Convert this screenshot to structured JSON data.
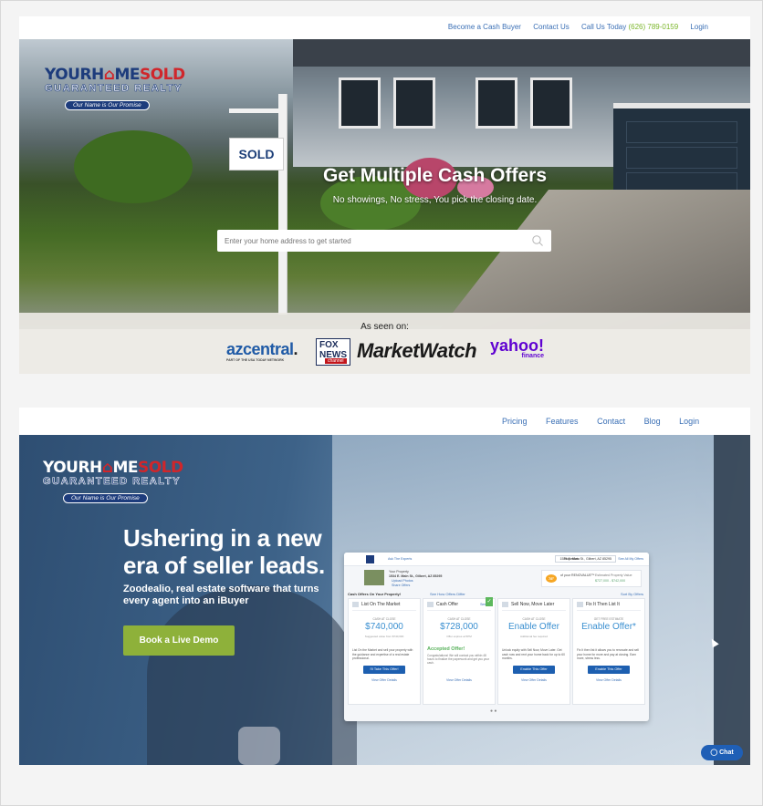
{
  "site1": {
    "nav": {
      "become_buyer": "Become a Cash Buyer",
      "contact": "Contact Us",
      "call_label": "Call Us Today",
      "phone": "(626) 789-0159",
      "login": "Login"
    },
    "logo": {
      "word_a": "YOURH",
      "word_b": "ME",
      "word_c": "SOLD",
      "o_glyph": "⌂",
      "line2": "GUARANTEED REALTY",
      "tagline": "Our Name is Our Promise"
    },
    "sign_text": "SOLD",
    "headline": "Get Multiple Cash Offers",
    "subheadline": "No showings, No stress, You pick the closing date.",
    "search_placeholder": "Enter your home address to get started",
    "press": {
      "seen_on": "As seen on:",
      "azcentral": "azcentral",
      "azcentral_dot": ".",
      "azcentral_small": "PART OF THE USA TODAY NETWORK",
      "fox_top": "FOX",
      "fox_mid": "NEWS",
      "fox_bottom": "channel",
      "marketwatch": "MarketWatch",
      "yahoo": "yahoo!",
      "yahoo_sub": "finance"
    }
  },
  "site2": {
    "nav": [
      "Pricing",
      "Features",
      "Contact",
      "Blog",
      "Login"
    ],
    "logo": {
      "word_a": "YOURH",
      "word_b": "ME",
      "word_c": "SOLD",
      "o_glyph": "⌂",
      "line2": "GUARANTEED REALTY",
      "tagline": "Our Name is Our Promise"
    },
    "headline": "Ushering in a new era of seller leads.",
    "subheadline": "Zoodealio, real estate software that turns every agent into an iBuyer",
    "demo_button": "Book a Live Demo",
    "dashboard": {
      "agent": "Ask The Experts",
      "properties_label": "Properties:",
      "address": "1534 E. Main St., Gilbert, AZ 85295",
      "see_all": "See All My Offers",
      "your_property": "Your Property",
      "prop_address": "1534 E. Main St., Gilbert, AZ 85295",
      "upload_photos": "Upload Photos",
      "share_offers": "Share Offers",
      "temp": "78°",
      "market_value": "of your RENOVALUE™",
      "estimate_label": "Estimated Property Value",
      "estimate_value": "$727,000 - $742,000",
      "cash_offers_heading": "Cash Offers On Your Property!",
      "see_how": "See How Offers Differ",
      "sort": "Sort By Offers",
      "cards": [
        {
          "title": "List On The Market",
          "label": "CASH AT CLOSE",
          "value": "$740,000",
          "sub": "Suggested value from $740,000",
          "desc": "List On the Market and sell your property with the guidance and expertise of a real estate professional.",
          "button": "I'll Take This Offer!",
          "link": "View Offer Details"
        },
        {
          "title": "Cash Offer",
          "see_all": "See All",
          "check": "✓",
          "label": "CASH AT CLOSE",
          "value": "$728,000",
          "sub": "Offer expires at 5PM",
          "accepted": "Accepted Offer!",
          "accepted_desc": "Congratulations! We will contact you within 48 hours to finalize the paperwork and get you your cash.",
          "link": "View Offer Details"
        },
        {
          "title": "Sell Now, Move Later",
          "label": "CASH AT CLOSE",
          "value": "Enable Offer",
          "sub": "Additional fee required",
          "desc": "Unlock equity with Sell Now, Move Later. Get cash now and rent your home back for up to 60 months.",
          "button": "Enable This Offer",
          "link": "View Offer Details"
        },
        {
          "title": "Fix It Then List It",
          "label": "GET FREE ESTIMATE",
          "value": "Enable Offer*",
          "sub": "",
          "desc": "Fix It then list it allows you to renovate and sell your home for more and pay at closing. Earn more, stress less.",
          "button": "Enable This Offer",
          "link": "View Offer Details"
        }
      ],
      "pager": "● ●"
    },
    "chat": "◯ Chat"
  }
}
